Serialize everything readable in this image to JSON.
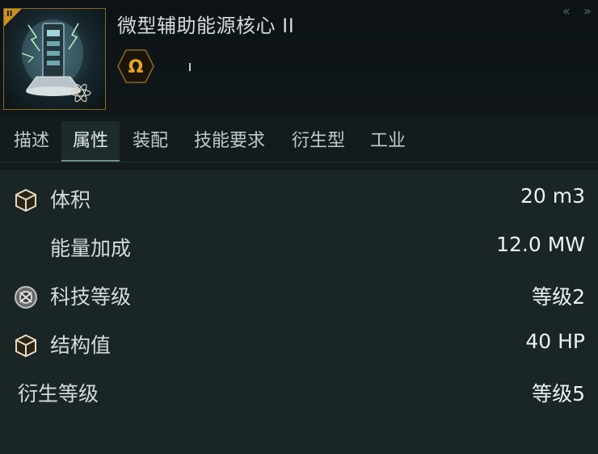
{
  "item": {
    "title": "微型辅助能源核心 II",
    "tech_level_badge": "II",
    "icon": "capacitor-core-icon",
    "meta_icon": "omega-icon",
    "meta_marker": "ı"
  },
  "window_controls": {
    "collapse_icons": [
      "«",
      "»"
    ]
  },
  "tabs": [
    {
      "label": "描述",
      "active": false
    },
    {
      "label": "属性",
      "active": true
    },
    {
      "label": "装配",
      "active": false
    },
    {
      "label": "技能要求",
      "active": false
    },
    {
      "label": "衍生型",
      "active": false
    },
    {
      "label": "工业",
      "active": false
    }
  ],
  "attributes": [
    {
      "label": "体积",
      "value": "20 m3",
      "icon": "cube-icon"
    },
    {
      "label": "能量加成",
      "value": "12.0 MW",
      "icon": ""
    },
    {
      "label": "科技等级",
      "value": "等级2",
      "icon": "tech-gear-icon"
    },
    {
      "label": "结构值",
      "value": "40 HP",
      "icon": "cube-icon"
    },
    {
      "label": "衍生等级",
      "value": "等级5",
      "icon": ""
    }
  ],
  "colors": {
    "accent_gold": "#c8901e",
    "panel_bg": "#1a2526",
    "tab_active_bg": "#1e2b2c"
  }
}
